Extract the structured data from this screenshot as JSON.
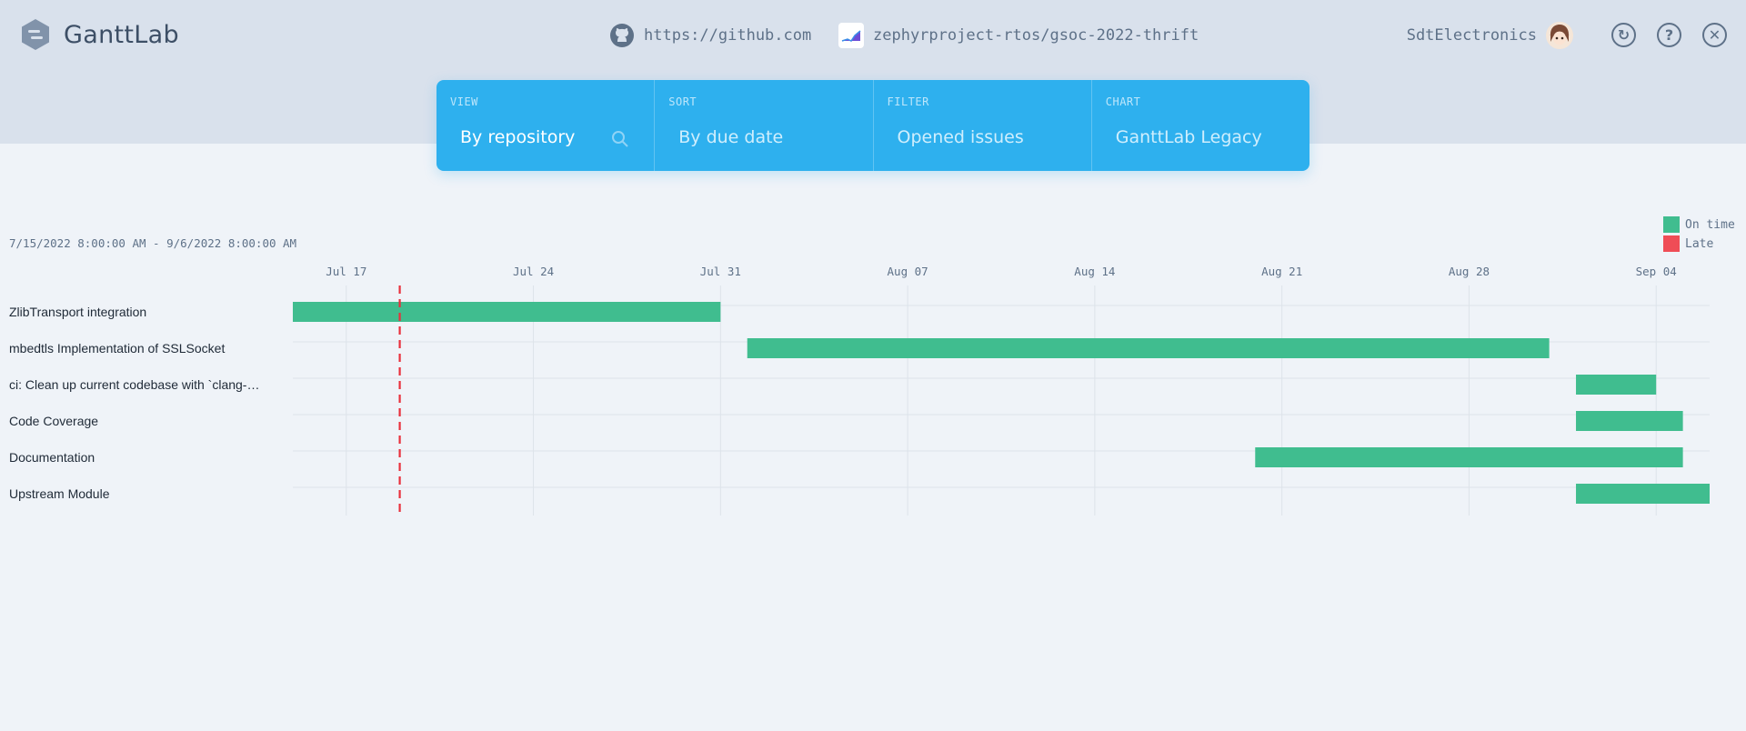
{
  "app": {
    "title": "GanttLab"
  },
  "header": {
    "source_url": "https://github.com",
    "project": "zephyrproject-rtos/gsoc-2022-thrift",
    "user": "SdtElectronics"
  },
  "toolbar": {
    "buttons": [
      {
        "name": "refresh-button",
        "icon": "refresh-icon",
        "glyph": "↻"
      },
      {
        "name": "help-button",
        "icon": "help-icon",
        "glyph": "?"
      },
      {
        "name": "close-button",
        "icon": "close-icon",
        "glyph": "✕"
      }
    ]
  },
  "controls": {
    "view": {
      "label": "VIEW",
      "value": "By repository"
    },
    "sort": {
      "label": "SORT",
      "value": "By due date"
    },
    "filter": {
      "label": "FILTER",
      "value": "Opened issues"
    },
    "chart": {
      "label": "CHART",
      "value": "GanttLab Legacy"
    }
  },
  "colors": {
    "on_time": "#40bd8f",
    "late": "#ef4d56",
    "accent": "#2eb0ee",
    "today_line": "#e8303c"
  },
  "chart_data": {
    "type": "gantt",
    "date_range": "7/15/2022 8:00:00 AM - 9/6/2022 8:00:00 AM",
    "range_start": "2022-07-15T08:00",
    "range_end": "2022-09-06T08:00",
    "today": "2022-07-19T08:00",
    "ticks": [
      {
        "label": "Jul 17",
        "date": "2022-07-17"
      },
      {
        "label": "Jul 24",
        "date": "2022-07-24"
      },
      {
        "label": "Jul 31",
        "date": "2022-07-31"
      },
      {
        "label": "Aug 07",
        "date": "2022-08-07"
      },
      {
        "label": "Aug 14",
        "date": "2022-08-14"
      },
      {
        "label": "Aug 21",
        "date": "2022-08-21"
      },
      {
        "label": "Aug 28",
        "date": "2022-08-28"
      },
      {
        "label": "Sep 04",
        "date": "2022-09-04"
      }
    ],
    "legend": [
      {
        "label": "On time",
        "color": "#40bd8f"
      },
      {
        "label": "Late",
        "color": "#ef4d56"
      }
    ],
    "tasks": [
      {
        "name": "ZlibTransport integration",
        "start": "2022-07-15T08:00",
        "end": "2022-07-31T08:00",
        "status": "on_time"
      },
      {
        "name": "mbedtls Implementation of SSLSocket",
        "start": "2022-08-01T08:00",
        "end": "2022-08-31T08:00",
        "status": "on_time"
      },
      {
        "name": "ci: Clean up current codebase with `clang-…",
        "start": "2022-09-01T08:00",
        "end": "2022-09-04T08:00",
        "status": "on_time"
      },
      {
        "name": "Code Coverage",
        "start": "2022-09-01T08:00",
        "end": "2022-09-05T08:00",
        "status": "on_time"
      },
      {
        "name": "Documentation",
        "start": "2022-08-20T08:00",
        "end": "2022-09-05T08:00",
        "status": "on_time"
      },
      {
        "name": "Upstream Module",
        "start": "2022-09-01T08:00",
        "end": "2022-09-06T08:00",
        "status": "on_time"
      }
    ]
  }
}
